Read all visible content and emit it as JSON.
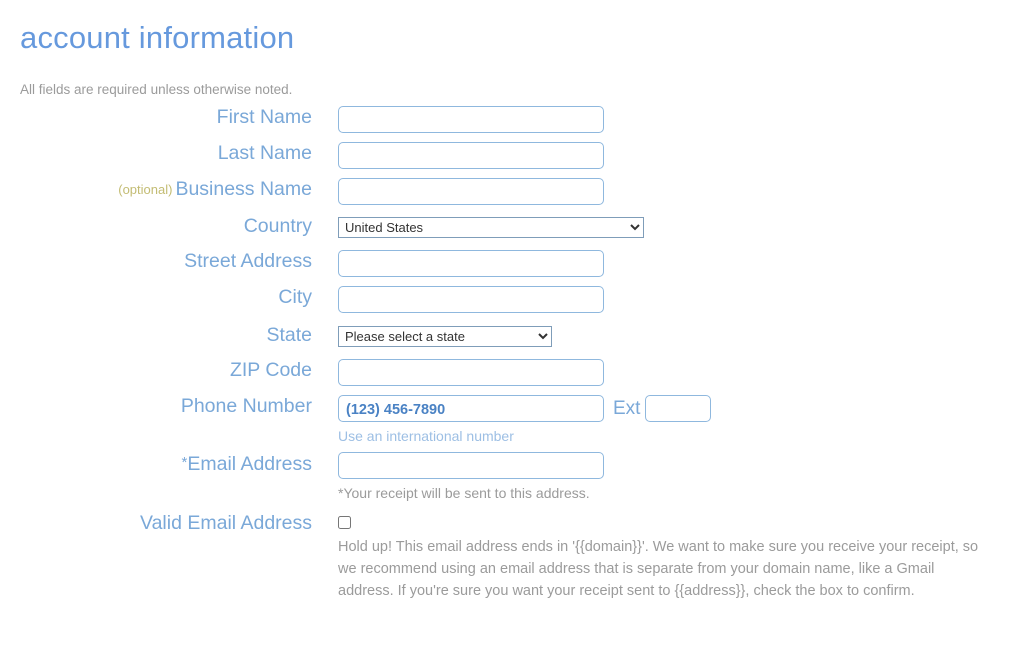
{
  "header": {
    "title": "account information",
    "subtitle": "All fields are required unless otherwise noted."
  },
  "colors": {
    "title": "#6699dd",
    "label": "#7aa8d8",
    "optional": "#c3bc73",
    "input_border": "#8fb8de",
    "input_text": "#4a82c4",
    "hint_grey": "#9b9b9b",
    "hint_link": "#9dbfe4"
  },
  "form": {
    "first_name": {
      "label": "First Name",
      "value": "",
      "placeholder": ""
    },
    "last_name": {
      "label": "Last Name",
      "value": "",
      "placeholder": ""
    },
    "business_name": {
      "optional_tag": "(optional)",
      "label": "Business Name",
      "value": "",
      "placeholder": ""
    },
    "country": {
      "label": "Country",
      "selected": "United States",
      "options": [
        "United States"
      ],
      "icon": "chevron-down-icon"
    },
    "street_address": {
      "label": "Street Address",
      "value": "",
      "placeholder": ""
    },
    "city": {
      "label": "City",
      "value": "",
      "placeholder": ""
    },
    "state": {
      "label": "State",
      "selected": "Please select a state",
      "options": [
        "Please select a state"
      ],
      "icon": "chevron-down-icon"
    },
    "zip_code": {
      "label": "ZIP Code",
      "value": "",
      "placeholder": ""
    },
    "phone_number": {
      "label": "Phone Number",
      "value": "",
      "placeholder": "(123) 456-7890",
      "ext_label": "Ext",
      "ext_value": "",
      "ext_placeholder": "",
      "hint": "Use an international number"
    },
    "email_address": {
      "asterisk": "*",
      "label": "Email Address",
      "value": "",
      "placeholder": "",
      "hint": "*Your receipt will be sent to this address."
    },
    "valid_email_address": {
      "label": "Valid Email Address",
      "checked": false,
      "warning": "Hold up! This email address ends in '{{domain}}'. We want to make sure you receive your receipt, so we recommend using an email address that is separate from your domain name, like a Gmail address. If you're sure you want your receipt sent to {{address}}, check the box to confirm."
    }
  }
}
